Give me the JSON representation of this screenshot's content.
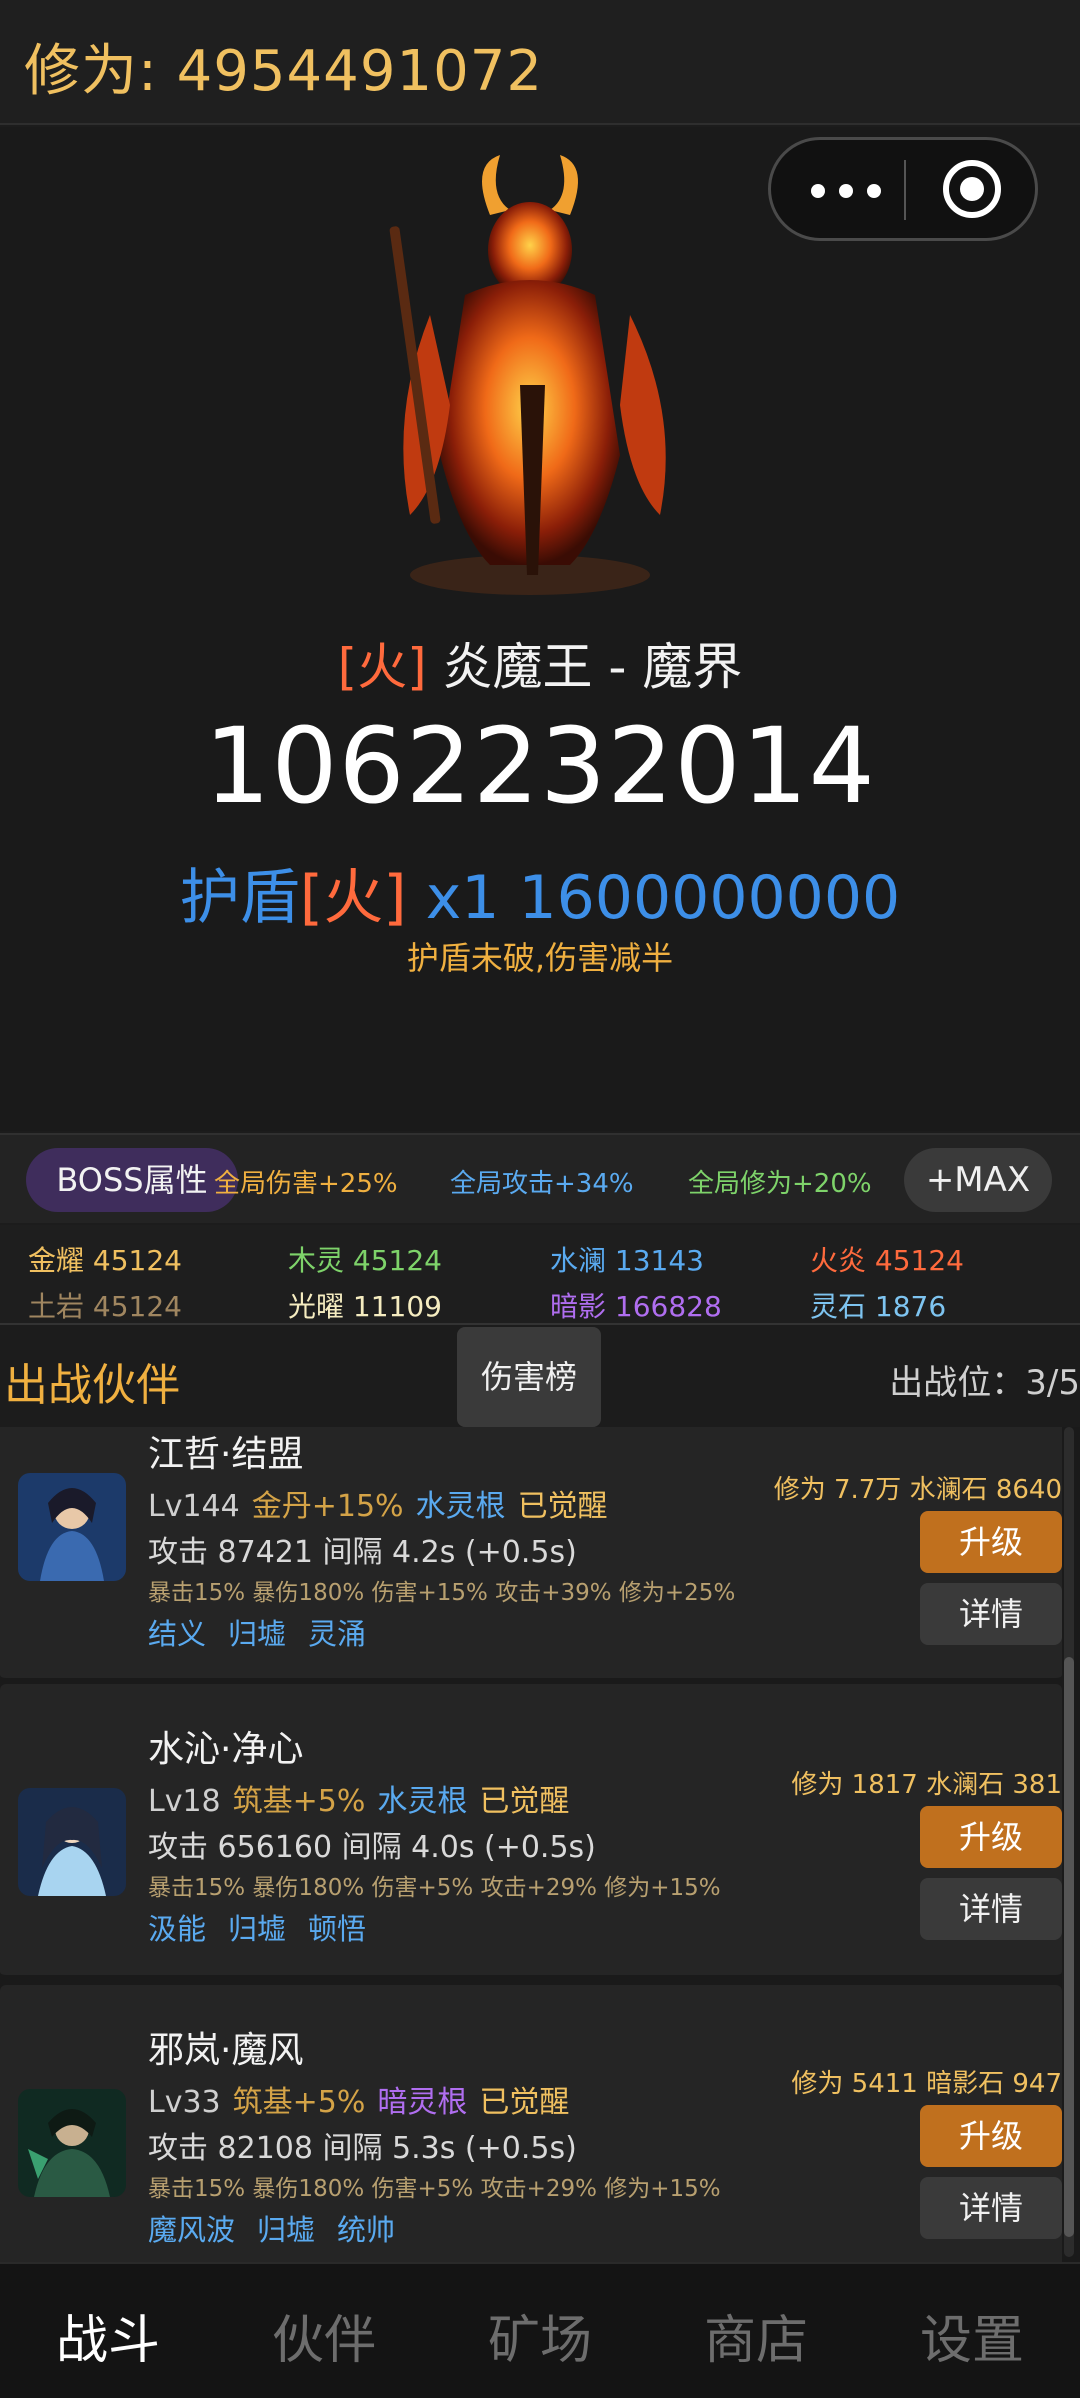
{
  "header": {
    "cultivation": "修为: 4954491072"
  },
  "capsule": {
    "more_icon": "more-dots-icon",
    "close_icon": "target-icon"
  },
  "boss": {
    "element_tag": "[火]",
    "name": "炎魔王 - 魔界",
    "hp": "1062232014",
    "shield_label": "护盾",
    "shield_element": "[火]",
    "shield_count": "x1",
    "shield_value": "1600000000",
    "shield_note": "护盾未破,伤害减半"
  },
  "buffs": {
    "boss_attr_button": "BOSS属性",
    "global_damage": "全局伤害+25%",
    "global_attack": "全局攻击+34%",
    "global_cultivation": "全局修为+20%",
    "max_button": "+MAX"
  },
  "elements": [
    {
      "label": "金耀 45124",
      "color": "#f0c060"
    },
    {
      "label": "木灵 45124",
      "color": "#7ed36a"
    },
    {
      "label": "水澜 13143",
      "color": "#5aaaf0"
    },
    {
      "label": "火炎 45124",
      "color": "#ff6a3d"
    },
    {
      "label": "土岩 45124",
      "color": "#a08660"
    },
    {
      "label": "光曜 11109",
      "color": "#f5ecc0"
    },
    {
      "label": "暗影 166828",
      "color": "#b06ef0"
    },
    {
      "label": "灵石 1876",
      "color": "#7ec4f0"
    }
  ],
  "partners_section": {
    "title": "出战伙伴",
    "damage_rank_tab": "伤害榜",
    "slots": "出战位：3/5"
  },
  "partners": [
    {
      "name": "江哲·结盟",
      "level": "Lv144",
      "realm": "金丹+15%",
      "root": "水灵根",
      "awakened": "已觉醒",
      "attack": "攻击 87421  间隔 4.2s (+0.5s)",
      "stats": "暴击15% 暴伤180% 伤害+15% 攻击+39% 修为+25%",
      "skills": [
        "结义",
        "归墟",
        "灵涌"
      ],
      "cost": "修为 7.7万  水澜石 8640",
      "upgrade": "升级",
      "detail": "详情"
    },
    {
      "name": "水沁·净心",
      "level": "Lv18",
      "realm": "筑基+5%",
      "root": "水灵根",
      "awakened": "已觉醒",
      "attack": "攻击 656160  间隔 4.0s (+0.5s)",
      "stats": "暴击15% 暴伤180% 伤害+5% 攻击+29% 修为+15%",
      "skills": [
        "汲能",
        "归墟",
        "顿悟"
      ],
      "cost": "修为 1817  水澜石 381",
      "upgrade": "升级",
      "detail": "详情"
    },
    {
      "name": "邪岚·魔风",
      "level": "Lv33",
      "realm": "筑基+5%",
      "root": "暗灵根",
      "awakened": "已觉醒",
      "attack": "攻击 82108  间隔 5.3s (+0.5s)",
      "stats": "暴击15% 暴伤180% 伤害+5% 攻击+29% 修为+15%",
      "skills": [
        "魔风波",
        "归墟",
        "统帅"
      ],
      "cost": "修为 5411  暗影石 947",
      "upgrade": "升级",
      "detail": "详情"
    }
  ],
  "nav": [
    "战斗",
    "伙伴",
    "矿场",
    "商店",
    "设置"
  ]
}
